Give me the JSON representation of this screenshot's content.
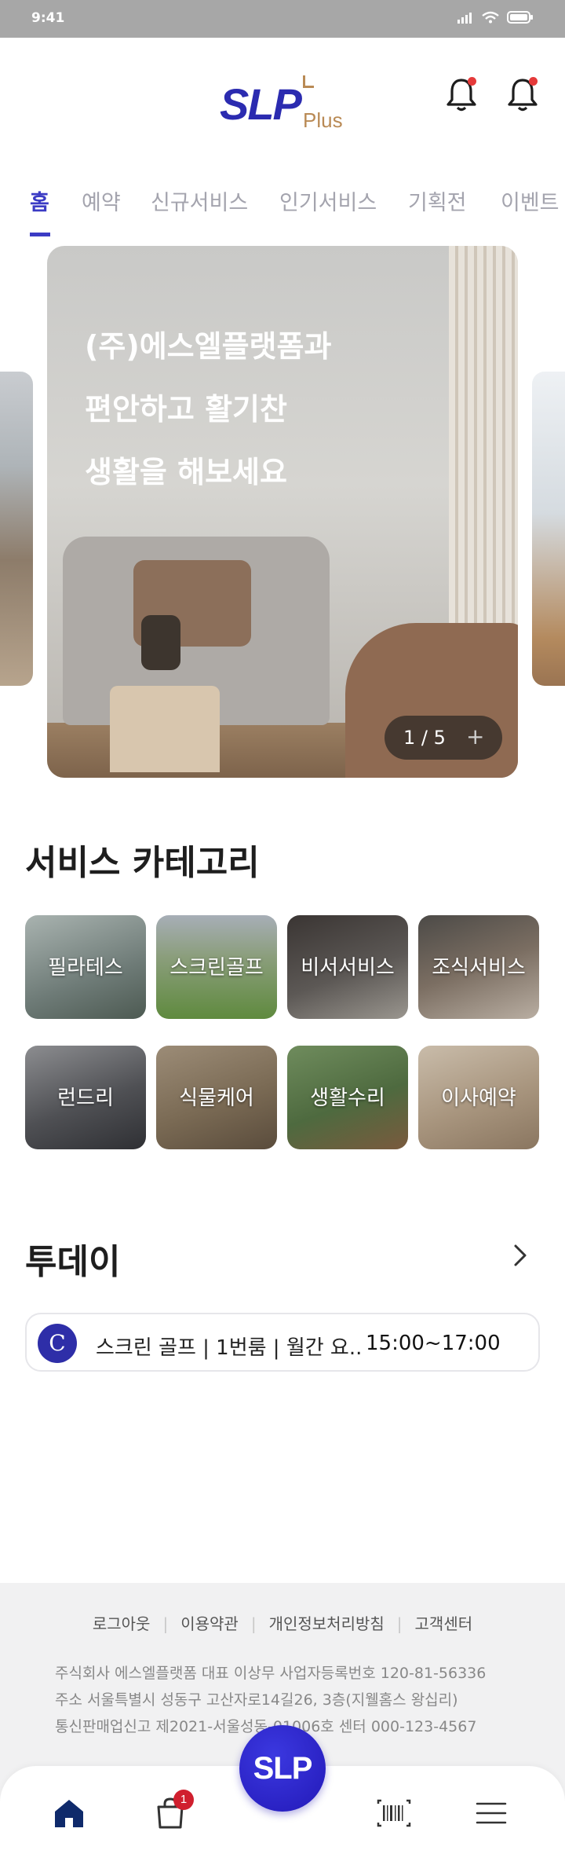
{
  "status_bar": {
    "time": "9:41"
  },
  "header": {
    "logo_main": "SLP",
    "logo_sub": "Plus"
  },
  "tabs": [
    {
      "label": "홈"
    },
    {
      "label": "예약"
    },
    {
      "label": "신규서비스"
    },
    {
      "label": "인기서비스"
    },
    {
      "label": "기획전"
    },
    {
      "label": "이벤트"
    }
  ],
  "active_tab": "홈",
  "carousel": {
    "headline": [
      "(주)에스엘플랫폼과",
      "편안하고 활기찬",
      "생활을 해보세요"
    ],
    "pager": "1 / 5",
    "pager_plus": "+"
  },
  "categories": {
    "title": "서비스 카테고리",
    "items": [
      {
        "label": "필라테스",
        "color": "#7f8a86"
      },
      {
        "label": "스크린골프",
        "color": "#6f8d57"
      },
      {
        "label": "비서서비스",
        "color": "#4f4d4c"
      },
      {
        "label": "조식서비스",
        "color": "#6b6560"
      },
      {
        "label": "런드리",
        "color": "#5e5f62"
      },
      {
        "label": "식물케어",
        "color": "#8b7a64"
      },
      {
        "label": "생활수리",
        "color": "#56704a"
      },
      {
        "label": "이사예약",
        "color": "#a89682"
      }
    ]
  },
  "today": {
    "title": "투데이",
    "items": [
      {
        "avatar": "C",
        "text": "스크린 골프 | 1번룸 | 월간 요..",
        "time": "15:00~17:00"
      }
    ]
  },
  "footer": {
    "links": [
      "로그아웃",
      "이용약관",
      "개인정보처리방침",
      "고객센터"
    ],
    "info": [
      "주식회사 에스엘플랫폼    대표  이상무    사업자등록번호  120-81-56336",
      "주소  서울특별시 성동구 고산자로14길26, 3층(지웰홈스 왕십리)",
      "통신판매업신고  제2021-서울성동-01006호    센터  000-123-4567"
    ]
  },
  "bottom_nav": {
    "fab_label": "SLP",
    "cart_badge": "1",
    "items": [
      "home-icon",
      "shopping-bag-icon",
      "barcode-icon",
      "menu-icon"
    ]
  },
  "colors": {
    "accent": "#3b3bc4",
    "badge": "#d01f2e",
    "tab_inactive": "#a4a4ae"
  }
}
